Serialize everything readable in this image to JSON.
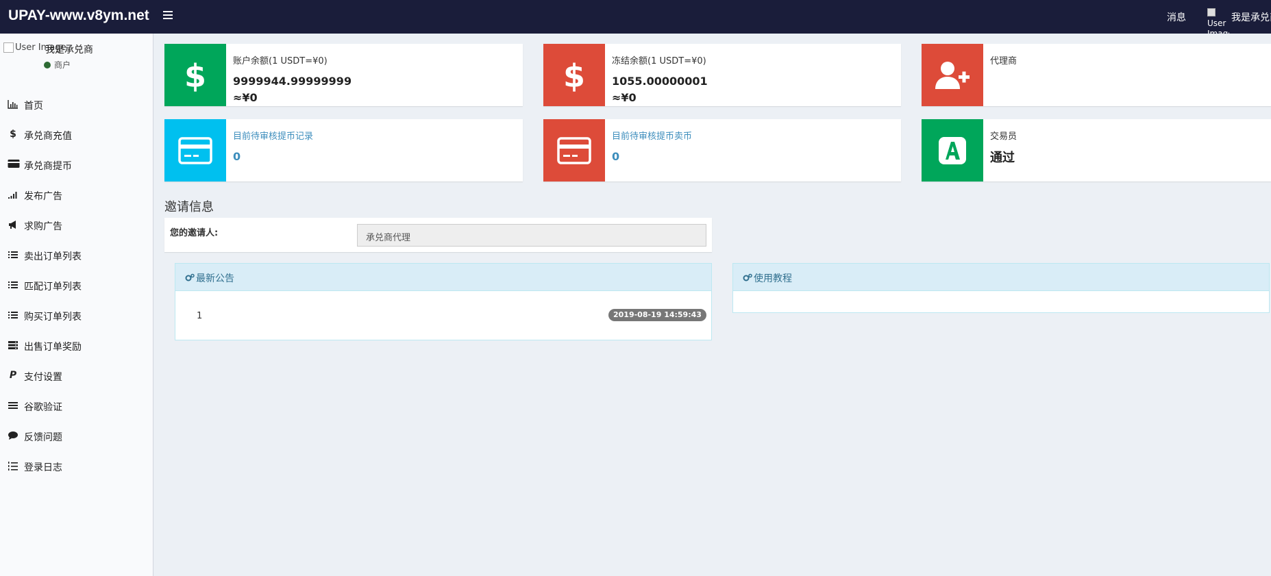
{
  "header": {
    "brand": "UPAY-www.v8ym.net",
    "messages": "消息",
    "user_image_alt": "User Image",
    "user_name": "我是承兑商"
  },
  "sidebar": {
    "user_image_alt": "User Image",
    "user_name": "我是承兑商",
    "status": "商户",
    "status_color": "#2e6b34",
    "items": [
      {
        "icon": "bar-chart-icon",
        "label": "首页"
      },
      {
        "icon": "dollar-icon",
        "label": "承兑商充值"
      },
      {
        "icon": "credit-card-icon",
        "label": "承兑商提币"
      },
      {
        "icon": "signal-icon",
        "label": "发布广告"
      },
      {
        "icon": "bullhorn-icon",
        "label": "求购广告"
      },
      {
        "icon": "list-icon",
        "label": "卖出订单列表"
      },
      {
        "icon": "list-icon",
        "label": "匹配订单列表"
      },
      {
        "icon": "list-icon",
        "label": "购买订单列表"
      },
      {
        "icon": "server-icon",
        "label": "出售订单奖励"
      },
      {
        "icon": "paypal-icon",
        "label": "支付设置"
      },
      {
        "icon": "bars-icon",
        "label": "谷歌验证"
      },
      {
        "icon": "comment-icon",
        "label": "反馈问题"
      },
      {
        "icon": "list-ol-icon",
        "label": "登录日志"
      }
    ]
  },
  "info_boxes": {
    "account_balance": {
      "label": "账户余额(1 USDT=¥0)",
      "value": "9999944.99999999",
      "cny": "≈¥0",
      "icon": "dollar-icon",
      "color": "#00a65a"
    },
    "frozen_balance": {
      "label": "冻结余额(1 USDT=¥0)",
      "value": "1055.00000001",
      "cny": "≈¥0",
      "icon": "dollar-icon",
      "color": "#dd4b39"
    },
    "agent": {
      "label": "代理商",
      "icon": "user-plus-icon",
      "color": "#dd4b39"
    },
    "pending_withdraw": {
      "label": "目前待审核提币记录",
      "value": "0",
      "icon": "credit-card-icon",
      "color": "#00c0ef"
    },
    "pending_sell": {
      "label": "目前待审核提币卖币",
      "value": "0",
      "icon": "credit-card-icon",
      "color": "#dd4b39"
    },
    "trader": {
      "label": "交易员",
      "value": "通过",
      "icon": "app-a-icon",
      "color": "#00a65a"
    }
  },
  "invite": {
    "title": "邀请信息",
    "label": "您的邀请人:",
    "value": "承兑商代理"
  },
  "announcements": {
    "title": "最新公告",
    "items": [
      {
        "text": "1",
        "date": "2019-08-19 14:59:43"
      }
    ]
  },
  "tutorials": {
    "title": "使用教程"
  }
}
